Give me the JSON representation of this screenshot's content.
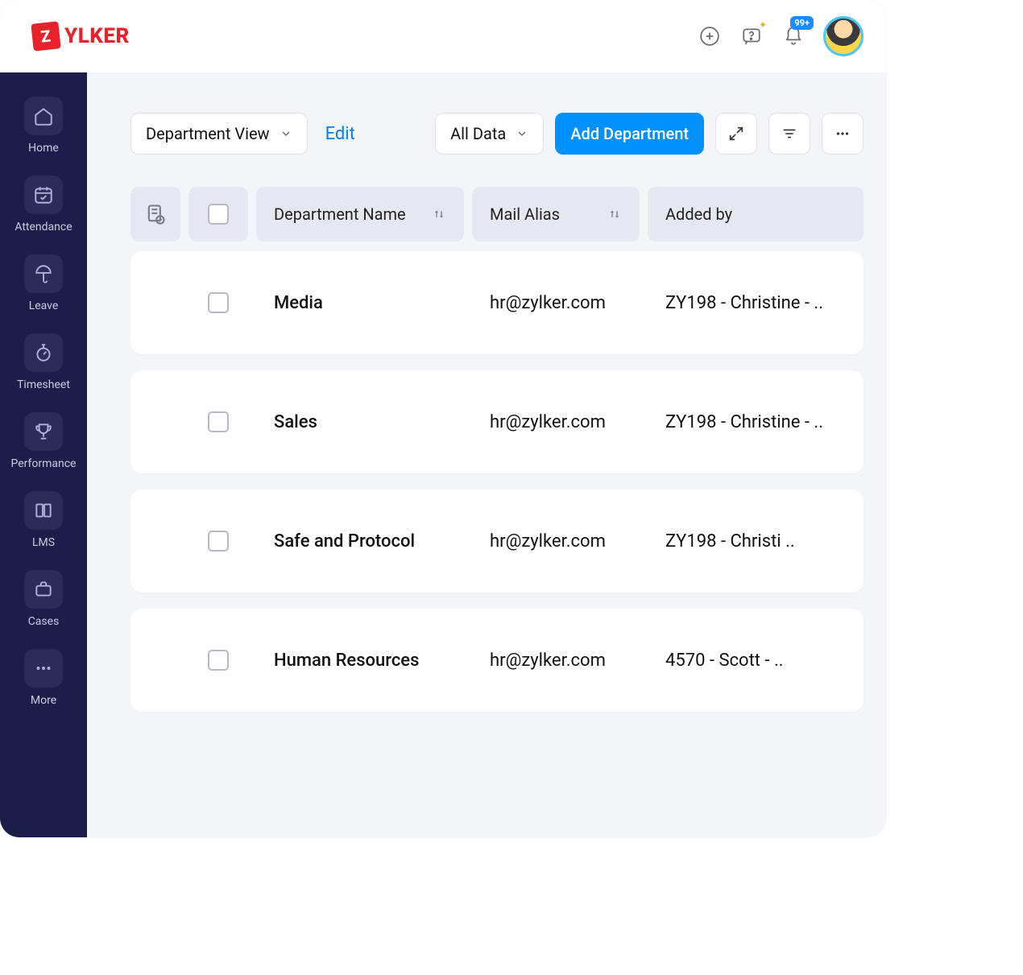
{
  "brand": {
    "badge": "Z",
    "name": "YLKER"
  },
  "header": {
    "notifications_badge": "99+"
  },
  "sidebar": {
    "items": [
      {
        "label": "Home"
      },
      {
        "label": "Attendance"
      },
      {
        "label": "Leave"
      },
      {
        "label": "Timesheet"
      },
      {
        "label": "Performance"
      },
      {
        "label": "LMS"
      },
      {
        "label": "Cases"
      },
      {
        "label": "More"
      }
    ]
  },
  "toolbar": {
    "view_label": "Department View",
    "edit_label": "Edit",
    "filter_label": "All Data",
    "add_label": "Add Department"
  },
  "table": {
    "columns": {
      "name": "Department Name",
      "mail": "Mail Alias",
      "added": "Added by"
    },
    "rows": [
      {
        "name": "Media",
        "mail": "hr@zylker.com",
        "added": "ZY198 - Christine - .."
      },
      {
        "name": "Sales",
        "mail": "hr@zylker.com",
        "added": "ZY198 - Christine - .."
      },
      {
        "name": "Safe and Protocol",
        "mail": "hr@zylker.com",
        "added": "ZY198 - Christi .."
      },
      {
        "name": "Human Resources",
        "mail": "hr@zylker.com",
        "added": "4570 - Scott - .."
      }
    ]
  }
}
